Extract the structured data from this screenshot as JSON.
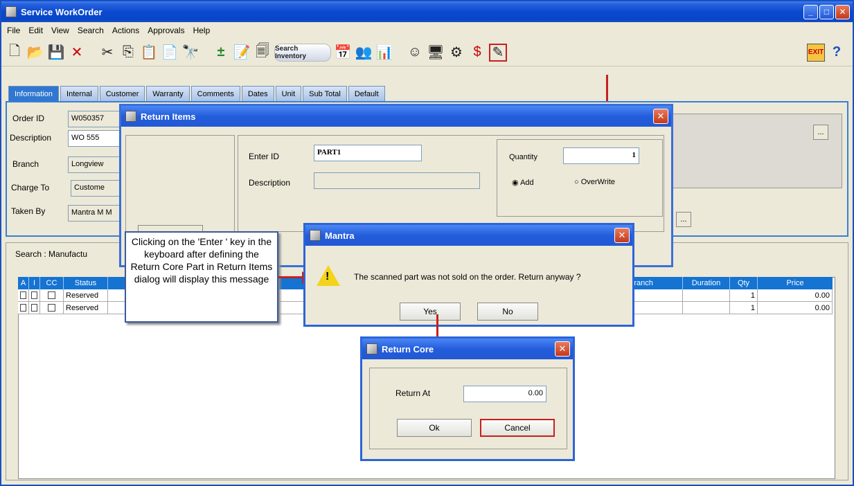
{
  "window": {
    "title": "Service WorkOrder"
  },
  "menu": [
    "File",
    "Edit",
    "View",
    "Search",
    "Actions",
    "Approvals",
    "Help"
  ],
  "toolbar": {
    "search_inventory_label": "Search Inventory",
    "exit_label": "EXIT"
  },
  "tabs": [
    "Information",
    "Internal",
    "Customer",
    "Warranty",
    "Comments",
    "Dates",
    "Unit",
    "Sub Total",
    "Default"
  ],
  "info": {
    "order_id_label": "Order ID",
    "order_id_value": "W050357",
    "description_label": "Description",
    "description_value": "WO 555",
    "branch_label": "Branch",
    "branch_value": "Longview",
    "charge_to_label": "Charge To",
    "charge_to_value": "Custome",
    "taken_by_label": "Taken By",
    "taken_by_value": "Mantra M M",
    "dots": "..."
  },
  "grid": {
    "search_label": "Search :  Manufactu",
    "headers": [
      "A",
      "I",
      "CC",
      "Status",
      "Branch",
      "Duration",
      "Qty",
      "Price"
    ],
    "rows": [
      {
        "status": "Reserved",
        "qty": "1",
        "price": "0.00"
      },
      {
        "status": "Reserved",
        "qty": "1",
        "price": "0.00"
      }
    ]
  },
  "return_items": {
    "title": "Return Items",
    "enter_id_label": "Enter ID",
    "enter_id_value": "PART1",
    "description_label": "Description",
    "quantity_label": "Quantity",
    "quantity_value": "1",
    "add_label": "Add",
    "overwrite_label": "OverWrite"
  },
  "mantra": {
    "title": "Mantra",
    "message": "The scanned part was not sold on the order. Return anyway ?",
    "yes": "Yes",
    "no": "No"
  },
  "return_core": {
    "title": "Return Core",
    "return_at_label": "Return At",
    "return_at_value": "0.00",
    "ok": "Ok",
    "cancel": "Cancel"
  },
  "callout": {
    "text": "Clicking on the 'Enter ' key in the keyboard after defining the Return Core Part in Return Items dialog will display this message"
  },
  "colors": {
    "accent": "#c62020",
    "title_blue": "#0a4ad0",
    "grid_header": "#1573d2"
  }
}
